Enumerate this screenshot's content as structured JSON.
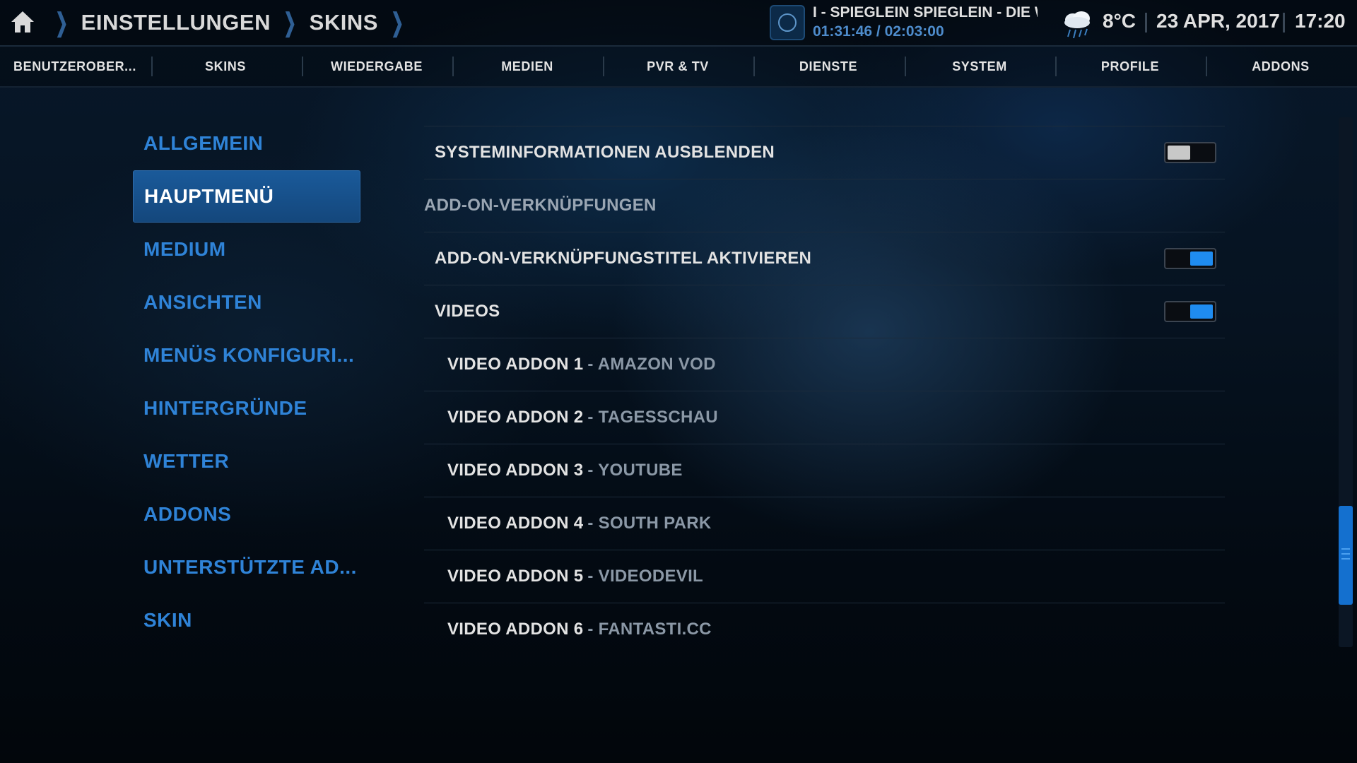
{
  "header": {
    "breadcrumb": [
      "EINSTELLUNGEN",
      "SKINS"
    ],
    "now_playing": {
      "title": "I  - SPIEGLEIN SPIEGLEIN - DIE W",
      "time": "01:31:46 / 02:03:00"
    },
    "weather": {
      "icon": "rain-cloud-icon",
      "temperature": "8°C"
    },
    "date": "23 APR, 2017",
    "clock": "17:20"
  },
  "categories": [
    "BENUTZEROBER...",
    "SKINS",
    "WIEDERGABE",
    "MEDIEN",
    "PVR & TV",
    "DIENSTE",
    "SYSTEM",
    "PROFILE",
    "ADDONS"
  ],
  "menu": {
    "items": [
      "ALLGEMEIN",
      "HAUPTMENÜ",
      "MEDIUM",
      "ANSICHTEN",
      "MENÜS KONFIGURI...",
      "HINTERGRÜNDE",
      "WETTER",
      "ADDONS",
      "UNTERSTÜTZTE AD...",
      "SKIN"
    ],
    "active": "HAUPTMENÜ"
  },
  "settings": {
    "hide_sysinfo": {
      "label": "SYSTEMINFORMATIONEN AUSBLENDEN",
      "enabled": false
    },
    "section_title": "ADD-ON-VERKNÜPFUNGEN",
    "addon_titles": {
      "label": "ADD-ON-VERKNÜPFUNGSTITEL AKTIVIEREN",
      "enabled": true
    },
    "videos": {
      "label": "VIDEOS",
      "enabled": true
    },
    "video_addons": [
      {
        "label": "VIDEO ADDON 1",
        "value": "- AMAZON VOD"
      },
      {
        "label": "VIDEO ADDON 2",
        "value": "- TAGESSCHAU"
      },
      {
        "label": "VIDEO ADDON 3",
        "value": "- YOUTUBE"
      },
      {
        "label": "VIDEO ADDON 4",
        "value": "- SOUTH PARK"
      },
      {
        "label": "VIDEO ADDON 5",
        "value": "- VIDEODEVIL"
      },
      {
        "label": "VIDEO ADDON 6",
        "value": "- FANTASTI.CC"
      }
    ]
  },
  "colors": {
    "accent": "#2f83d7",
    "toggle_on": "#1f8cf0",
    "active_menu": "#14477c"
  }
}
